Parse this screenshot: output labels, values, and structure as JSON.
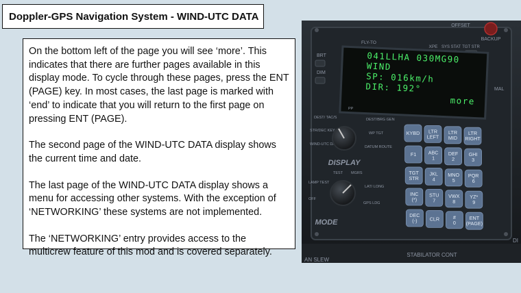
{
  "title": "Doppler-GPS Navigation System - WIND-UTC DATA",
  "paragraphs": [
    "On the bottom left of the page you will see ‘more’. This indicates that there are further pages available in this display mode. To cycle through these pages, press the ENT (PAGE) key. In most cases, the last page is marked with ‘end’ to indicate that you will return to the first page on pressing ENT (PAGE).",
    "The second page of the WIND-UTC DATA display shows the current time and date.",
    "The last page of the WIND-UTC DATA display shows a menu for accessing other systems. With the exception of ‘NETWORKING’ these systems are not implemented.",
    "The ‘NETWORKING’ entry provides access to the multicrew feature of this mod and is covered separately."
  ],
  "panel": {
    "top_labels": [
      "FLY-TO",
      "XPE",
      "SYS STAT",
      "TGT STR",
      "BACKUP",
      "OFFSET"
    ],
    "side_labels": [
      "BRT",
      "DIM",
      "MAL"
    ],
    "screen_lines": [
      "041LLHA   030MG90",
      "WIND",
      "SP: 016km/h",
      "DIR: 192°",
      "more"
    ],
    "keys": [
      [
        "KYBD",
        "LTR LEFT",
        "LTR MID",
        "LTR RIGHT"
      ],
      [
        "F1",
        "ABC 1",
        "DEF 2",
        "GHI 3"
      ],
      [
        "TGT STR",
        "JKL 4",
        "MNO 5",
        "PQR 6"
      ],
      [
        "INC (*)",
        "STU 7",
        "VWX 8",
        "YZ* 9"
      ],
      [
        "DEC (-)",
        "CLR",
        "# 0",
        "ENT (PAGE)"
      ]
    ],
    "display_knob": {
      "title": "DISPLAY",
      "labels": [
        "DEST/ TAC/S",
        "PP",
        "DEST/BRG GEN",
        "STR/DEC KEY",
        "WP TGT",
        "WIND-UTC DATA",
        "DATUM ROUTE"
      ]
    },
    "mode_knob": {
      "title": "MODE",
      "labels": [
        "TEST",
        "MGRS",
        "LAMP TEST",
        "LAT/ LONG",
        "OFF",
        "GPS LDG"
      ]
    },
    "bottom_label": "STABILATOR CONT",
    "bottom_left_label": "AN SLEW",
    "right_edge_label": "DI"
  },
  "colors": {
    "screen_text": "#4cf06a",
    "key_face": "#5c7392",
    "panel_bg": "#1a1e22"
  }
}
